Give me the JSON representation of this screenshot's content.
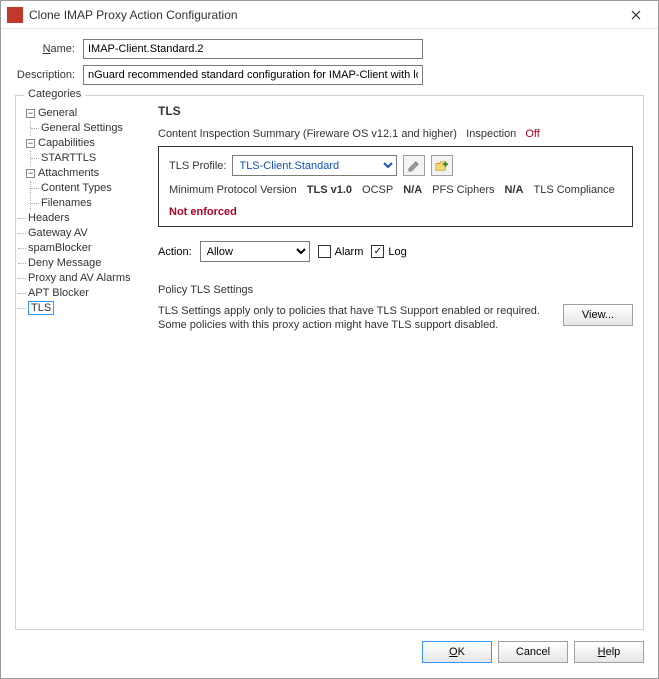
{
  "window": {
    "title": "Clone IMAP Proxy Action Configuration"
  },
  "form": {
    "name_label": "Name:",
    "name_value": "IMAP-Client.Standard.2",
    "desc_label": "Description:",
    "desc_value": "nGuard recommended standard configuration for IMAP-Client with logging enabled"
  },
  "categories": {
    "legend": "Categories",
    "tree": {
      "general": {
        "label": "General",
        "children": [
          {
            "label": "General Settings"
          }
        ]
      },
      "capabilities": {
        "label": "Capabilities",
        "children": [
          {
            "label": "STARTTLS"
          }
        ]
      },
      "attachments": {
        "label": "Attachments",
        "children": [
          {
            "label": "Content Types"
          },
          {
            "label": "Filenames"
          }
        ]
      },
      "flat": [
        {
          "label": "Headers"
        },
        {
          "label": "Gateway AV"
        },
        {
          "label": "spamBlocker"
        },
        {
          "label": "Deny Message"
        },
        {
          "label": "Proxy and AV Alarms"
        },
        {
          "label": "APT Blocker"
        },
        {
          "label": "TLS",
          "selected": true
        }
      ]
    }
  },
  "pane": {
    "title": "TLS",
    "summary_text": "Content Inspection Summary (Fireware OS v12.1 and higher)",
    "inspection_label": "Inspection",
    "inspection_value": "Off",
    "profile": {
      "label": "TLS Profile:",
      "value": "TLS-Client.Standard",
      "info": {
        "min_proto_k": "Minimum Protocol Version",
        "min_proto_v": "TLS v1.0",
        "ocsp_k": "OCSP",
        "ocsp_v": "N/A",
        "pfs_k": "PFS Ciphers",
        "pfs_v": "N/A",
        "compliance_k": "TLS Compliance",
        "compliance_v": "Not enforced"
      }
    },
    "action": {
      "label": "Action:",
      "value": "Allow",
      "alarm_label": "Alarm",
      "alarm_checked": false,
      "log_label": "Log",
      "log_checked": true
    },
    "policy": {
      "heading": "Policy TLS Settings",
      "text": "TLS Settings apply only to policies that have TLS Support enabled or required. Some policies with this proxy action might have TLS support disabled.",
      "view_label": "View..."
    }
  },
  "footer": {
    "ok": "OK",
    "cancel": "Cancel",
    "help": "Help"
  }
}
